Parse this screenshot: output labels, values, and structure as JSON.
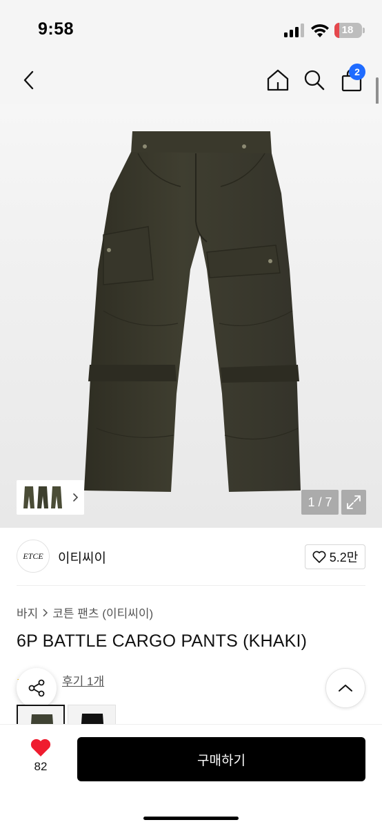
{
  "status_bar": {
    "time": "9:58",
    "battery_level": "18",
    "battery_fraction": 0.18
  },
  "nav": {
    "icons": [
      "back-chevron-icon",
      "home-icon",
      "search-icon",
      "shopping-bag-icon"
    ],
    "cart_count": "2"
  },
  "gallery": {
    "counter": "1 / 7",
    "expand_icon": "expand-icon"
  },
  "brand": {
    "logo_text": "ETCE",
    "name": "이티씨이",
    "likes": "5.2만"
  },
  "breadcrumb": {
    "category": "바지",
    "subcategory": "코튼 팬츠 (이티씨이)"
  },
  "product": {
    "title": "6P BATTLE CARGO PANTS (KHAKI)"
  },
  "reviews": {
    "link_text": "후기 1개"
  },
  "bottom": {
    "heart_count": "82",
    "buy_label": "구매하기"
  },
  "colors": {
    "brand_accent": "#1f6bff",
    "like_red": "#ef1c2f",
    "buy_button": "#000000",
    "pants_khaki": "#3b3a2c"
  }
}
